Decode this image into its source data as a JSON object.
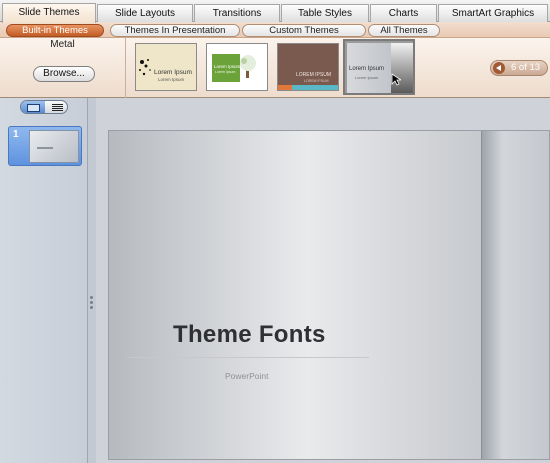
{
  "ribbon_tabs": [
    "Slide Themes",
    "Slide Layouts",
    "Transitions",
    "Table Styles",
    "Charts",
    "SmartArt Graphics"
  ],
  "sub_tabs": [
    "Built-in Themes",
    "Themes In Presentation",
    "Custom Themes",
    "All Themes"
  ],
  "theme_group": {
    "name": "Metal",
    "browse_label": "Browse..."
  },
  "theme_thumbs": [
    {
      "name": "theme-lorem-ipsum-cream",
      "caption": "Lorem Ipsum",
      "sub": "Lorem Ipsum"
    },
    {
      "name": "theme-lorem-ipsum-green",
      "caption": "Lorem Ipsum",
      "sub": "Lorem Ipsum"
    },
    {
      "name": "theme-lorem-ipsum-brown",
      "caption": "LOREM IPSUM",
      "sub": "LOREM IPSUM"
    },
    {
      "name": "theme-lorem-ipsum-metal",
      "caption": "Lorem Ipsum",
      "sub": "Lorem Ipsum"
    }
  ],
  "pager": {
    "text": "6 of 13"
  },
  "slides_pane": {
    "slides": [
      {
        "number": "1"
      }
    ]
  },
  "slide": {
    "title": "Theme Fonts",
    "subtitle": "PowerPoint"
  },
  "colors": {
    "accent_orange": "#c25e27",
    "ribbon_bg": "#f1e0d2",
    "selection_blue": "#5f93df"
  }
}
